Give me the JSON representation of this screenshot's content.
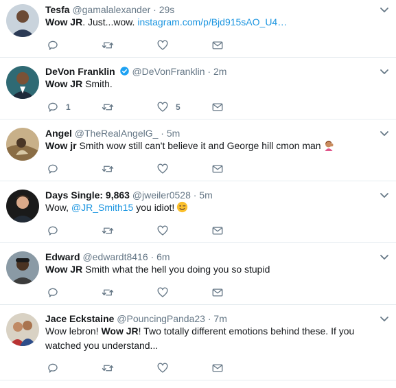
{
  "tweets": [
    {
      "name": "Tesfa",
      "handle": "@gamalalexander",
      "time": "29s",
      "verified": false,
      "text_pre_bold": "",
      "bold": "Wow JR",
      "text_after": ". Just...wow. ",
      "link": "instagram.com/p/Bjd915sAO_U4…",
      "replies": "",
      "likes": "",
      "avatar_color": "#3b4a5e"
    },
    {
      "name": "DeVon Franklin",
      "handle": "@DeVonFranklin",
      "time": "2m",
      "verified": true,
      "bold": "Wow JR",
      "text_after": " Smith.",
      "replies": "1",
      "likes": "5",
      "avatar_color": "#1f3a4d"
    },
    {
      "name": "Angel",
      "handle": "@TheRealAngelG_",
      "time": "5m",
      "verified": false,
      "bold": "Wow jr",
      "text_after": " Smith wow still can't believe it and George hill cmon man",
      "emoji": "facepalm-emoji",
      "replies": "",
      "likes": "",
      "avatar_color": "#a38860"
    },
    {
      "name": "Days Single: 9,863",
      "handle": "@jweiler0528",
      "time": "5m",
      "verified": false,
      "text_pre": "Wow, ",
      "mention": "@JR_Smith15",
      "text_after": " you idiot!",
      "emoji": "wink-emoji",
      "replies": "",
      "likes": "",
      "avatar_color": "#2c2c2c"
    },
    {
      "name": "Edward",
      "handle": "@edwardt8416",
      "time": "6m",
      "verified": false,
      "bold": "Wow JR",
      "text_after": " Smith what the hell you doing you so stupid",
      "replies": "",
      "likes": "",
      "avatar_color": "#5a4a3a"
    },
    {
      "name": "Jace Eckstaine",
      "handle": "@PouncingPanda23",
      "time": "7m",
      "verified": false,
      "text_pre": "Wow lebron! ",
      "bold": "Wow JR",
      "text_after": "!  Two totally different emotions behind these. If you watched you understand...",
      "replies": "",
      "likes": "",
      "avatar_color": "#b03a3a"
    }
  ],
  "separator": "·",
  "colors": {
    "link": "#1b95e0",
    "muted": "#657786",
    "verified": "#1da1f2",
    "icon": "#657786"
  },
  "icons": [
    "reply-icon",
    "retweet-icon",
    "like-icon",
    "message-icon",
    "chevron-down-icon",
    "verified-badge-icon"
  ]
}
